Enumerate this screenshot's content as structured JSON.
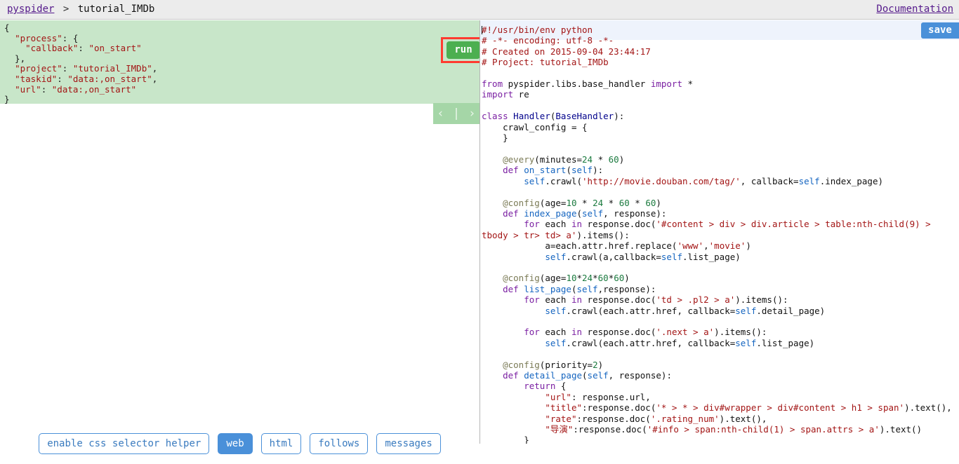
{
  "header": {
    "breadcrumb_link": "pyspider",
    "breadcrumb_separator": ">",
    "breadcrumb_current": "tutorial_IMDb",
    "documentation_label": "Documentation"
  },
  "debugger": {
    "run_label": "run",
    "nav_prev": "‹",
    "nav_divider": "|",
    "nav_next": "›",
    "task_json": "{\n  \"process\": {\n    \"callback\": \"on_start\"\n  },\n  \"project\": \"tutorial_IMDb\",\n  \"taskid\": \"data:,on_start\",\n  \"url\": \"data:,on_start\"\n}",
    "task_json_fields": {
      "process_callback": "on_start",
      "project": "tutorial_IMDb",
      "taskid": "data:,on_start",
      "url": "data:,on_start"
    }
  },
  "toolbar": {
    "buttons": [
      {
        "label": "enable css selector helper",
        "active": false
      },
      {
        "label": "web",
        "active": true
      },
      {
        "label": "html",
        "active": false
      },
      {
        "label": "follows",
        "active": false
      },
      {
        "label": "messages",
        "active": false
      }
    ]
  },
  "editor": {
    "save_label": "save",
    "source": "#!/usr/bin/env python\n# -*- encoding: utf-8 -*-\n# Created on 2015-09-04 23:44:17\n# Project: tutorial_IMDb\n\nfrom pyspider.libs.base_handler import *\nimport re\n\nclass Handler(BaseHandler):\n    crawl_config = {\n    }\n\n    @every(minutes=24 * 60)\n    def on_start(self):\n        self.crawl('http://movie.douban.com/tag/', callback=self.index_page)\n\n    @config(age=10 * 24 * 60 * 60)\n    def index_page(self, response):\n        for each in response.doc('#content > div > div.article > table:nth-child(9) > tbody > tr> td> a').items():\n            a=each.attr.href.replace('www','movie')\n            self.crawl(a,callback=self.list_page)\n\n    @config(age=10*24*60*60)\n    def list_page(self,response):\n        for each in response.doc('td > .pl2 > a').items():\n            self.crawl(each.attr.href, callback=self.detail_page)\n\n        for each in response.doc('.next > a').items():\n            self.crawl(each.attr.href, callback=self.list_page)\n\n    @config(priority=2)\n    def detail_page(self, response):\n        return {\n            \"url\": response.url,\n            \"title\":response.doc('* > * > div#wrapper > div#content > h1 > span').text(),\n            \"rate\":response.doc('.rating_num').text(),\n            \"导演\":response.doc('#info > span:nth-child(1) > span.attrs > a').text()\n        }"
  },
  "colors": {
    "task_panel_bg": "#c8e6c9",
    "run_button_bg": "#4caf50",
    "save_button_bg": "#4a90d9",
    "highlight_box": "#ff3b30",
    "header_bg": "#ececec",
    "link": "#551a8b"
  }
}
